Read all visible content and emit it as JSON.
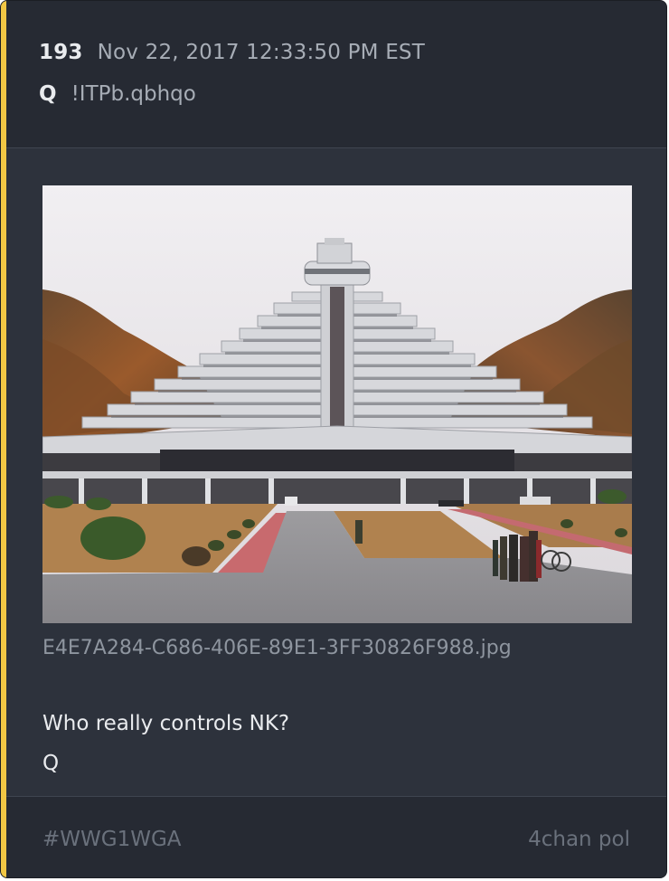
{
  "post": {
    "number": "193",
    "date": "Nov 22, 2017 12:33:50 PM EST",
    "author": "Q",
    "tripcode": "!ITPb.qbhqo"
  },
  "attachment": {
    "filename": "E4E7A284-C686-406E-89E1-3FF30826F988.jpg",
    "image_subject": "photo of a stepped pyramid-shaped hotel building with a central tower, surrounded by autumn hills, lawns and a group of people on the driveway"
  },
  "message": {
    "line1": "Who really controls NK?",
    "line2": "Q"
  },
  "footer": {
    "hashtag": "#WWG1WGA",
    "source": "4chan pol"
  },
  "colors": {
    "accent": "#f2c744",
    "card_background": "#2d323c",
    "header_background": "#262a33",
    "primary_text": "#e9ebee",
    "secondary_text": "#a7adb6",
    "muted_text": "#6a717c"
  }
}
